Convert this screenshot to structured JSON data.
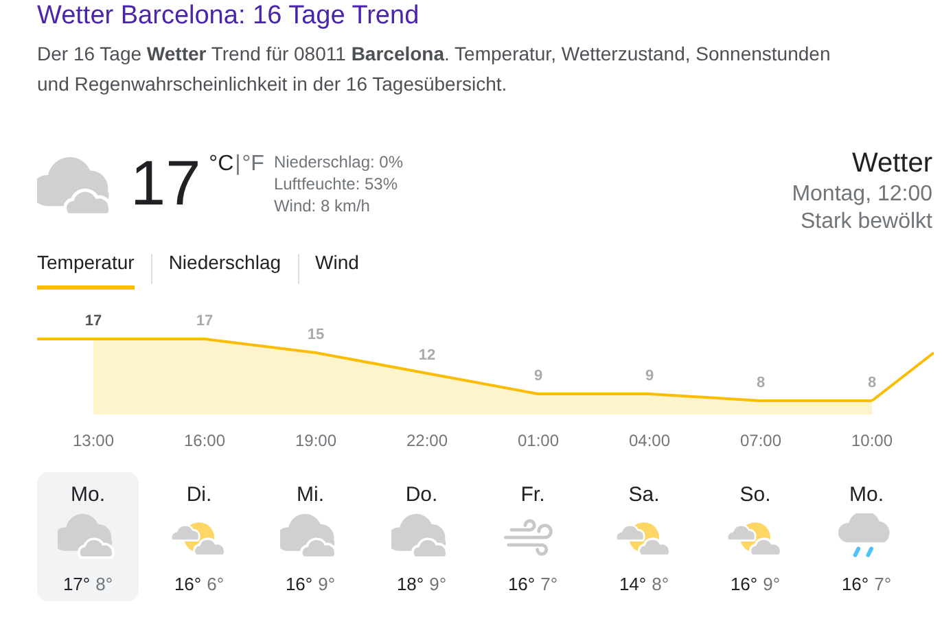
{
  "header": {
    "title": "Wetter Barcelona: 16 Tage Trend",
    "description": "Der 16 Tage **Wetter** Trend für 08011 **Barcelona**. Temperatur, Wetterzustand, Sonnenstunden und Regenwahrscheinlichkeit in der 16 Tagesübersicht."
  },
  "current": {
    "kind": "cloud",
    "temperature": "17",
    "unit_c": "°C",
    "separator": "|",
    "unit_f": "°F",
    "details": [
      "Niederschlag: 0%",
      "Luftfeuchte: 53%",
      "Wind: 8 km/h"
    ],
    "heading": "Wetter",
    "time": "Montag, 12:00",
    "condition": "Stark bewölkt"
  },
  "tabs": [
    {
      "label": "Temperatur",
      "selected": true
    },
    {
      "label": "Niederschlag",
      "selected": false
    },
    {
      "label": "Wind",
      "selected": false
    }
  ],
  "chart": {
    "chart_data": {
      "type": "area",
      "categories": [
        "13:00",
        "16:00",
        "19:00",
        "22:00",
        "01:00",
        "04:00",
        "07:00",
        "10:00"
      ],
      "values": [
        17,
        17,
        15,
        12,
        9,
        9,
        8,
        8
      ],
      "data_labels": true
    }
  },
  "days": [
    {
      "name": "Mo.",
      "kind": "cloud",
      "high": "17°",
      "low": "8°",
      "selected": true
    },
    {
      "name": "Di.",
      "kind": "partly",
      "high": "16°",
      "low": "6°",
      "selected": false
    },
    {
      "name": "Mi.",
      "kind": "cloud",
      "high": "16°",
      "low": "9°",
      "selected": false
    },
    {
      "name": "Do.",
      "kind": "cloud",
      "high": "18°",
      "low": "9°",
      "selected": false
    },
    {
      "name": "Fr.",
      "kind": "wind",
      "high": "16°",
      "low": "7°",
      "selected": false
    },
    {
      "name": "Sa.",
      "kind": "partly",
      "high": "14°",
      "low": "8°",
      "selected": false
    },
    {
      "name": "So.",
      "kind": "partly",
      "high": "16°",
      "low": "9°",
      "selected": false
    },
    {
      "name": "Mo.",
      "kind": "rain",
      "high": "16°",
      "low": "7°",
      "selected": false
    }
  ]
}
